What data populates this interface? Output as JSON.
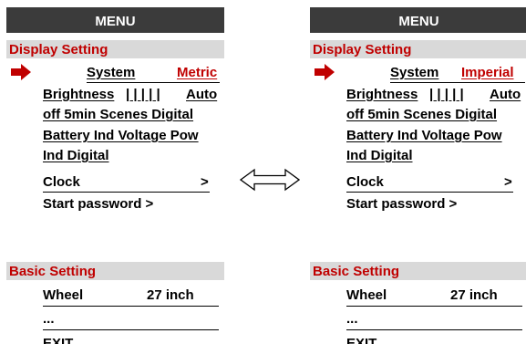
{
  "colors": {
    "header_bg": "#3b3b3b",
    "section_bg": "#d9d9d9",
    "accent_red": "#c00000"
  },
  "icons": {
    "pointer": "right-arrow-icon",
    "swap": "double-arrow-icon"
  },
  "left": {
    "header": "MENU",
    "display_section": "Display Setting",
    "system_label": "System",
    "system_value": "Metric",
    "line_brightness": "Brightness",
    "line_brightness_bars": "| | | | |",
    "line_brightness_auto": "Auto",
    "line_off": "off 5min Scenes Digital",
    "line_battery": "Battery Ind Voltage Pow",
    "line_ind": "Ind Digital",
    "clock_label": "Clock",
    "clock_arrow": ">",
    "password": "Start password >",
    "basic_section": "Basic Setting",
    "wheel_label": "Wheel",
    "wheel_value": "27 inch",
    "more": "...",
    "exit": "EXIT"
  },
  "right": {
    "header": "MENU",
    "display_section": "Display Setting",
    "system_label": "System",
    "system_value": "Imperial",
    "line_brightness": "Brightness",
    "line_brightness_bars": "| | | | |",
    "line_brightness_auto": "Auto",
    "line_off": "off 5min Scenes Digital",
    "line_battery": "Battery Ind Voltage Pow",
    "line_ind": "Ind Digital",
    "clock_label": "Clock",
    "clock_arrow": ">",
    "password": "Start password >",
    "basic_section": "Basic Setting",
    "wheel_label": "Wheel",
    "wheel_value": "27 inch",
    "more": "...",
    "exit": "EXIT"
  }
}
